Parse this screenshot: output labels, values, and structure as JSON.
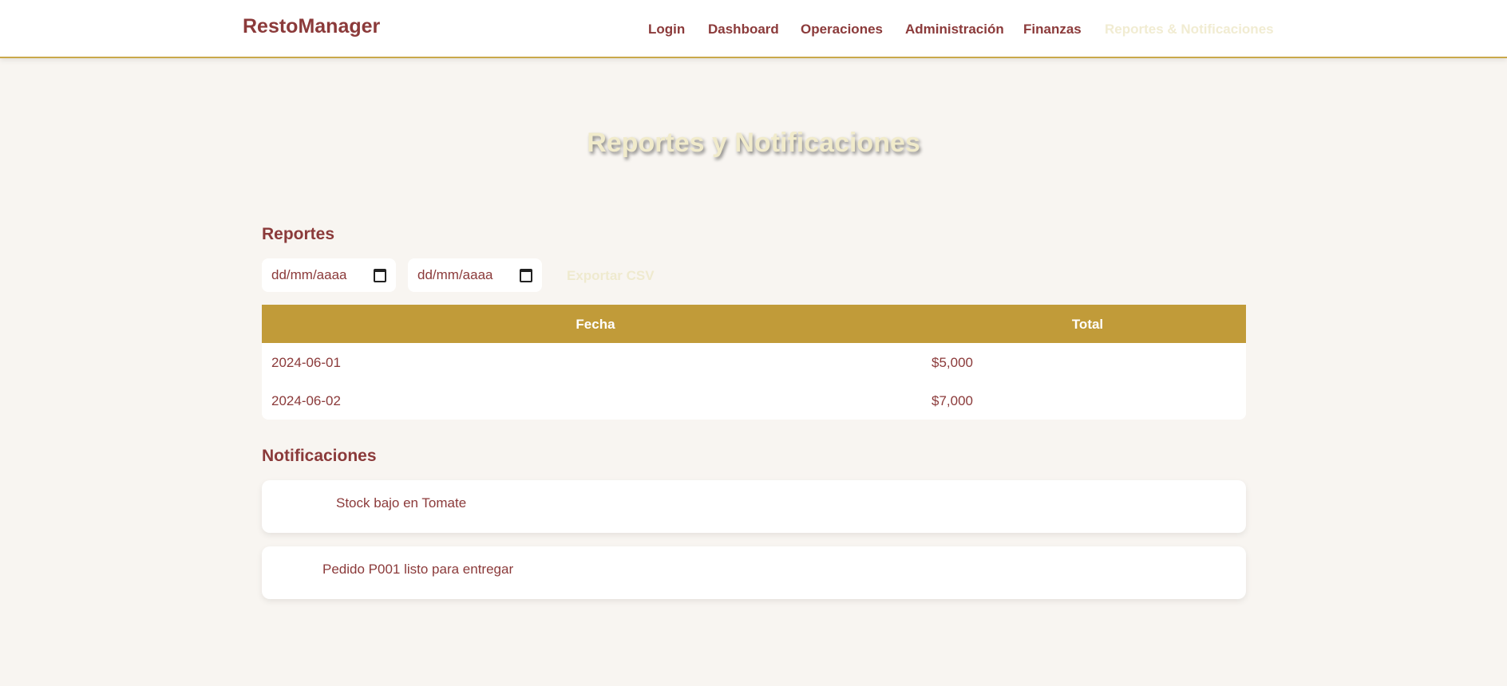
{
  "header": {
    "brand": "RestoManager",
    "nav": [
      {
        "label": "Login"
      },
      {
        "label": "Dashboard"
      },
      {
        "label": "Operaciones"
      },
      {
        "label": "Administración"
      },
      {
        "label": "Finanzas"
      },
      {
        "label": "Reportes & Notificaciones",
        "active": true
      }
    ]
  },
  "page": {
    "title": "Reportes y Notificaciones"
  },
  "reports": {
    "title": "Reportes",
    "date_from": {
      "placeholder": "dd/mm/aaaa"
    },
    "date_to": {
      "placeholder": "dd/mm/aaaa"
    },
    "export_label": "Exportar CSV",
    "table": {
      "columns": [
        "Fecha",
        "Total"
      ],
      "rows": [
        {
          "fecha": "2024-06-01",
          "total": "$5,000"
        },
        {
          "fecha": "2024-06-02",
          "total": "$7,000"
        }
      ]
    }
  },
  "notifications": {
    "title": "Notificaciones",
    "items": [
      {
        "text": "Stock bajo en Tomate"
      },
      {
        "text": "Pedido P001 listo para entregar"
      }
    ]
  },
  "colors": {
    "brand": "#8b3a3a",
    "accent": "#c19b39",
    "background": "#f8f5f1"
  }
}
